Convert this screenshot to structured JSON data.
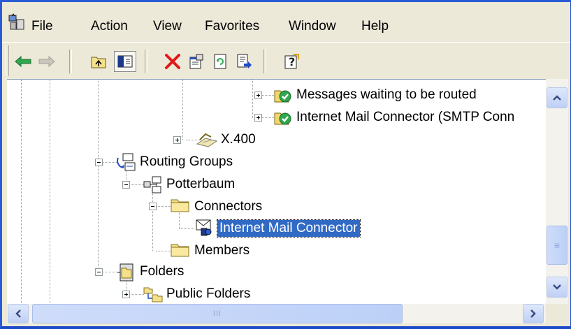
{
  "menubar": {
    "items": [
      {
        "label": "File"
      },
      {
        "label": "Action"
      },
      {
        "label": "View"
      },
      {
        "label": "Favorites"
      },
      {
        "label": "Window"
      },
      {
        "label": "Help"
      }
    ]
  },
  "toolbar": {
    "buttons": [
      "back-icon",
      "forward-icon",
      "up-one-level-icon",
      "show-hide-console-tree-icon",
      "delete-icon",
      "properties-icon",
      "refresh-icon",
      "export-list-icon",
      "help-icon"
    ]
  },
  "tree": {
    "nodes": [
      {
        "label": "Messages waiting to be routed"
      },
      {
        "label": "Internet Mail Connector (SMTP Conn"
      },
      {
        "label": "X.400"
      },
      {
        "label": "Routing Groups"
      },
      {
        "label": "Potterbaum"
      },
      {
        "label": "Connectors"
      },
      {
        "label": "Internet Mail Connector"
      },
      {
        "label": "Members"
      },
      {
        "label": "Folders"
      },
      {
        "label": "Public Folders"
      }
    ]
  },
  "scrollbars": {
    "hscroll_grip": "III",
    "vscroll_grip": "≡"
  },
  "colors": {
    "title_border": "#2a5bd7",
    "selection": "#316ac5",
    "chrome": "#ece9d8"
  }
}
